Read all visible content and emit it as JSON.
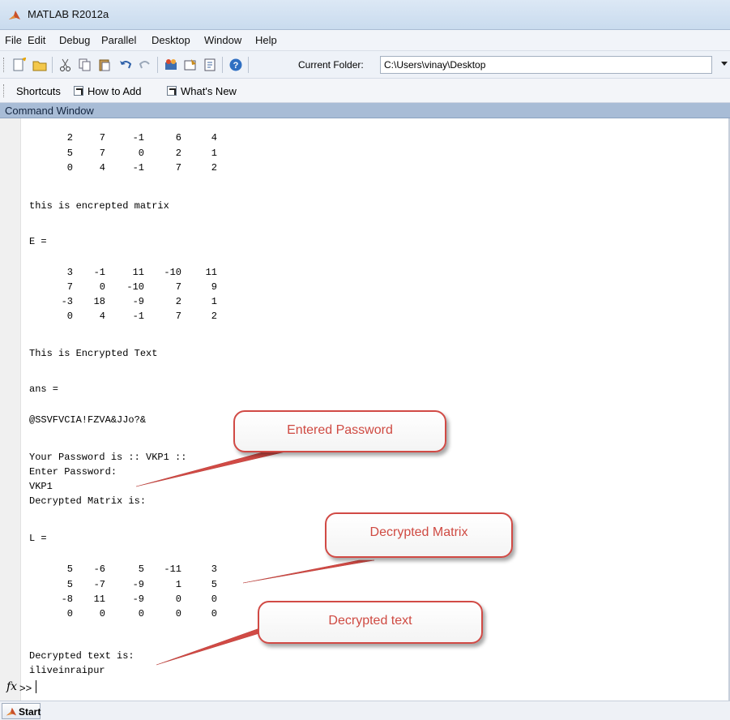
{
  "window": {
    "title": "MATLAB R2012a"
  },
  "menu": [
    "File",
    "Edit",
    "Debug",
    "Parallel",
    "Desktop",
    "Window",
    "Help"
  ],
  "toolbar": {
    "icons": [
      "new-file-icon",
      "open-folder-icon",
      "cut-icon",
      "copy-icon",
      "paste-icon",
      "undo-icon",
      "redo-icon",
      "simulink-icon",
      "guide-icon",
      "profiler-icon",
      "help-icon"
    ],
    "current_folder_label": "Current Folder:",
    "current_folder_value": "C:\\Users\\vinay\\Desktop"
  },
  "shortcuts": {
    "label": "Shortcuts",
    "how_to_add": "How to Add",
    "whats_new": "What's New"
  },
  "command_window": {
    "title": "Command Window",
    "first_matrix_rows": [
      [
        "2",
        "7",
        "-1",
        "6",
        "4"
      ],
      [
        "5",
        "7",
        "0",
        "2",
        "1"
      ],
      [
        "0",
        "4",
        "-1",
        "7",
        "2"
      ]
    ],
    "encrypted_matrix_msg": "this is encrepted matrix",
    "e_header": "E =",
    "e_rows": [
      [
        "3",
        "-1",
        "11",
        "-10",
        "11"
      ],
      [
        "7",
        "0",
        "-10",
        "7",
        "9"
      ],
      [
        "-3",
        "18",
        "-9",
        "2",
        "1"
      ],
      [
        "0",
        "4",
        "-1",
        "7",
        "2"
      ]
    ],
    "encrypted_text_msg": "This is Encrypted Text",
    "ans_header": "ans =",
    "ans_value": "@SSVFVCIA!FZVA&JJo?&",
    "password_line": "Your Password is :: VKP1 ::",
    "enter_password": "Enter Password:",
    "entered_password": "VKP1",
    "decrypted_matrix_msg": "Decrypted Matrix is:",
    "l_header": "L =",
    "l_rows": [
      [
        "5",
        "-6",
        "5",
        "-11",
        "3"
      ],
      [
        "5",
        "-7",
        "-9",
        "1",
        "5"
      ],
      [
        "-8",
        "11",
        "-9",
        "0",
        "0"
      ],
      [
        "0",
        "0",
        "0",
        "0",
        "0"
      ]
    ],
    "decrypted_text_msg": "Decrypted text is:",
    "decrypted_text": "iliveinraipur",
    "prompt_fx": "fx",
    "prompt": ">>"
  },
  "callouts": {
    "entered_password": "Entered Password",
    "decrypted_matrix": "Decrypted Matrix",
    "decrypted_text": "Decrypted text"
  },
  "statusbar": {
    "start": "Start"
  }
}
